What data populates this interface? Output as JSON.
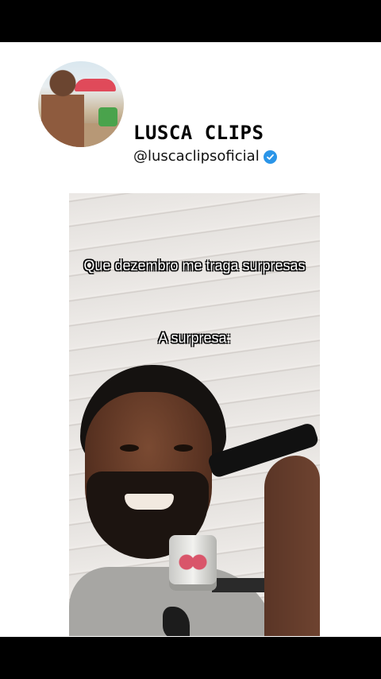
{
  "header": {
    "channel_name": "LUSCA CLIPS",
    "handle": "@luscaclipsoficial",
    "verified_icon": "verified-check-icon",
    "verified_color": "#2b95e8"
  },
  "video": {
    "caption_line1": "Que dezembro me traga surpresas",
    "caption_line2": "A surpresa:"
  },
  "colors": {
    "panel_background": "#ffffff",
    "letterbox": "#000000"
  }
}
